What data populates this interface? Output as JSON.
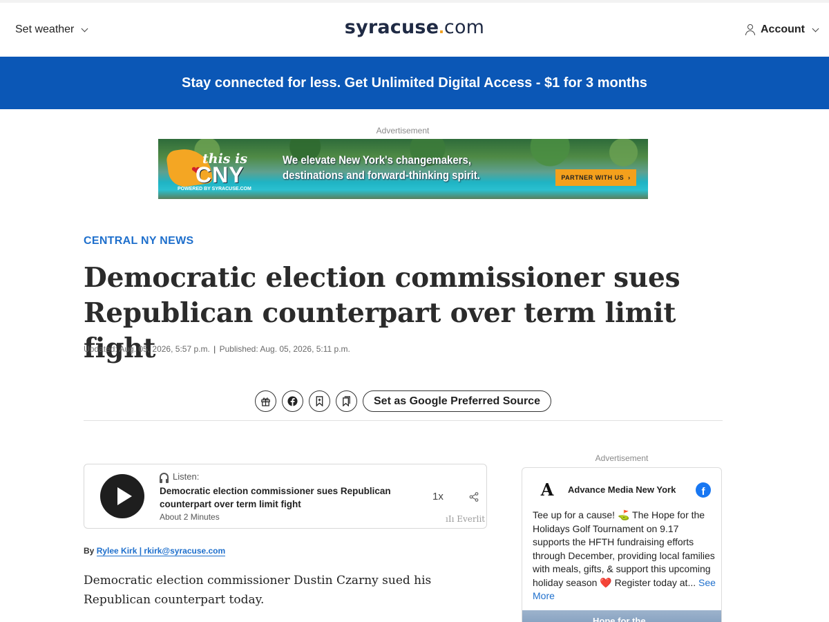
{
  "header": {
    "weather_label": "Set weather",
    "logo_brand": "syracuse",
    "logo_dot": ".",
    "logo_tld": "com",
    "account_label": "Account"
  },
  "promo": {
    "text": "Stay connected for less. Get Unlimited Digital Access - $1 for 3 months",
    "bg_color": "#0b57b6"
  },
  "top_ad": {
    "label": "Advertisement",
    "this_is": "this is",
    "cny": "CNY",
    "powered": "POWERED BY SYRACUSE.COM",
    "tagline_1": "We elevate New York's changemakers,",
    "tagline_2": "destinations and forward-thinking spirit.",
    "cta": "PARTNER WITH US"
  },
  "article": {
    "kicker": "CENTRAL NY NEWS",
    "headline": "Democratic election commissioner sues Republican counterpart over term limit fight",
    "updated": "Updated: Aug. 05, 2026, 5:57 p.m.",
    "separator": "|",
    "published": "Published: Aug. 05, 2026, 5:11 p.m.",
    "byline_prefix": "By",
    "author": "Rylee Kirk | rkirk@syracuse.com",
    "first_paragraph": "Democratic election commissioner Dustin Czarny sued his Republican counterpart today."
  },
  "share_bar": {
    "icons": [
      "gift-icon",
      "facebook-icon",
      "bookmark-icon",
      "bookmarks-icon"
    ],
    "preferred_label": "Set as Google Preferred Source"
  },
  "player": {
    "listen_label": "Listen:",
    "title": "Democratic election commissioner sues Republican counterpart over term limit fight",
    "duration": "About 2 Minutes",
    "speed": "1x",
    "brand": "Everlit"
  },
  "side_ad": {
    "label": "Advertisement",
    "logo_letter": "A",
    "page_name": "Advance Media New York",
    "text": "Tee up for a cause! ⛳ The Hope for the Holidays Golf Tournament on 9.17 supports the HFTH fundraising efforts through December, providing local families with meals, gifts, & support this upcoming holiday season ❤️ Register today at... ",
    "see_more": "See More",
    "image_caption": "Hope for the"
  },
  "colors": {
    "link_blue": "#1e6fcc",
    "logo_navy": "#1f2a44",
    "logo_dot_orange": "#f0a020",
    "facebook_blue": "#1877f2"
  }
}
